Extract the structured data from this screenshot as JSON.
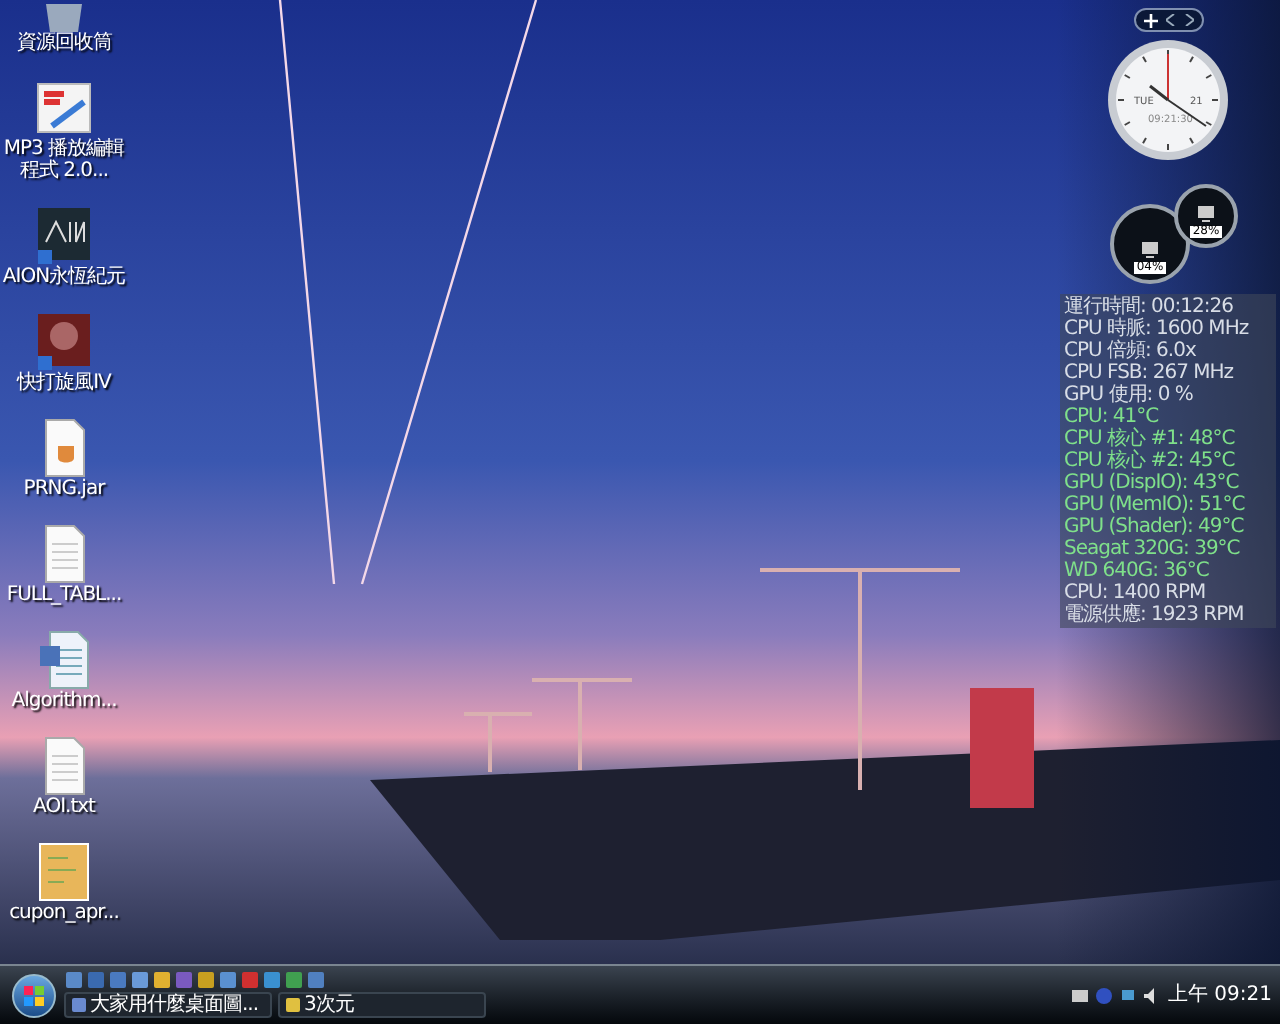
{
  "desktop_icons": [
    {
      "kind": "recycle",
      "label": "資源回收筒"
    },
    {
      "kind": "id3",
      "label": "MP3 播放編輯程式 2.0..."
    },
    {
      "kind": "aion",
      "label": "AION永恆紀元"
    },
    {
      "kind": "game",
      "label": "快打旋風IV"
    },
    {
      "kind": "jar",
      "label": "PRNG.jar"
    },
    {
      "kind": "doc",
      "label": "FULL_TABL..."
    },
    {
      "kind": "word",
      "label": "Algorithm..."
    },
    {
      "kind": "doc",
      "label": "AOI.txt"
    },
    {
      "kind": "image",
      "label": "cupon_apr..."
    }
  ],
  "clock": {
    "day": "TUE",
    "date": "21",
    "time": "09:21:30"
  },
  "gauges": [
    {
      "reading": "04%"
    },
    {
      "reading": "28%"
    }
  ],
  "monitor": [
    {
      "kind": "info",
      "text": "運行時間: 00:12:26"
    },
    {
      "kind": "info",
      "text": "CPU 時脈: 1600 MHz"
    },
    {
      "kind": "info",
      "text": "CPU 倍頻: 6.0x"
    },
    {
      "kind": "info",
      "text": "CPU FSB: 267 MHz"
    },
    {
      "kind": "info",
      "text": "GPU 使用: 0 %"
    },
    {
      "kind": "temp",
      "text": "CPU: 41°C"
    },
    {
      "kind": "temp",
      "text": "CPU 核心 #1: 48°C"
    },
    {
      "kind": "temp",
      "text": "CPU 核心 #2: 45°C"
    },
    {
      "kind": "temp",
      "text": "GPU (DispIO): 43°C"
    },
    {
      "kind": "temp",
      "text": "GPU (MemIO): 51°C"
    },
    {
      "kind": "temp",
      "text": "GPU (Shader): 49°C"
    },
    {
      "kind": "temp",
      "text": "Seagat 320G: 39°C"
    },
    {
      "kind": "temp",
      "text": "WD 640G: 36°C"
    },
    {
      "kind": "info",
      "text": "CPU: 1400 RPM"
    },
    {
      "kind": "info",
      "text": "電源供應: 1923 RPM"
    }
  ],
  "taskbar": {
    "tasks": [
      {
        "label": "大家用什麼桌面圖...",
        "selected": false
      },
      {
        "label": "3次元",
        "selected": false
      }
    ],
    "clock": "上午 09:21"
  }
}
